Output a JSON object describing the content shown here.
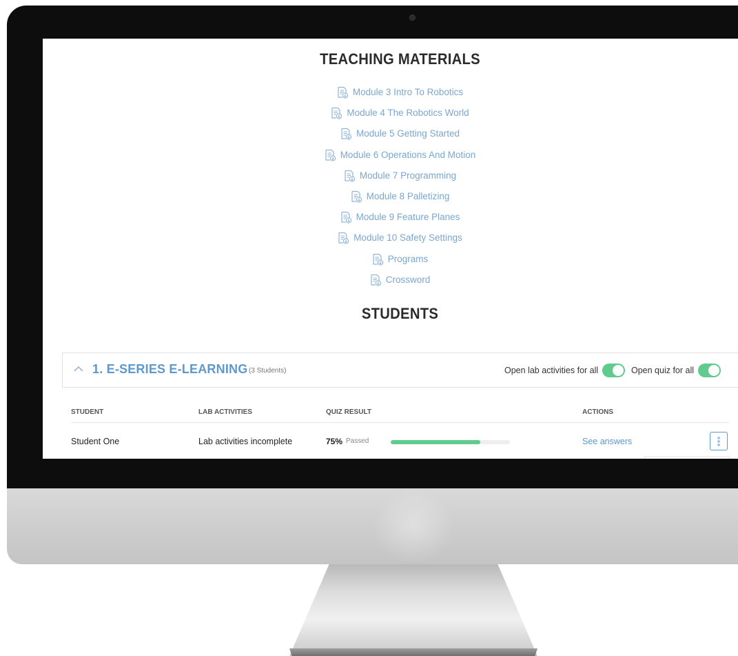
{
  "materials": {
    "title": "TEACHING MATERIALS",
    "items": [
      {
        "label": "Module 3 Intro To Robotics"
      },
      {
        "label": "Module 4 The Robotics World"
      },
      {
        "label": "Module 5 Getting Started"
      },
      {
        "label": "Module 6 Operations And Motion"
      },
      {
        "label": "Module 7 Programming"
      },
      {
        "label": "Module 8 Palletizing"
      },
      {
        "label": "Module 9 Feature Planes"
      },
      {
        "label": "Module 10 Safety Settings"
      },
      {
        "label": "Programs"
      },
      {
        "label": "Crossword"
      }
    ]
  },
  "students": {
    "title": "STUDENTS",
    "class": {
      "title": "1. E-SERIES E-LEARNING",
      "count": "(3 Students)",
      "lab_toggle": {
        "label": "Open lab activities for all",
        "on": true
      },
      "quiz_toggle": {
        "label": "Open quiz for all",
        "on": true
      }
    },
    "columns": [
      "STUDENT",
      "LAB ACTIVITIES",
      "QUIZ RESULT",
      "ACTIONS"
    ],
    "rows": [
      {
        "student": "Student One",
        "lab": "Lab activities incomplete",
        "quiz_pct": "75%",
        "quiz_status": "Passed",
        "quiz_fraction": 0.75,
        "action": "See answers"
      }
    ]
  },
  "colors": {
    "link": "#7aa6cf",
    "accent": "#5e98cc",
    "success": "#5fcb8c"
  },
  "icons": {
    "material": "document-download-icon",
    "collapse": "chevron-up-icon",
    "more": "kebab-menu-icon"
  }
}
